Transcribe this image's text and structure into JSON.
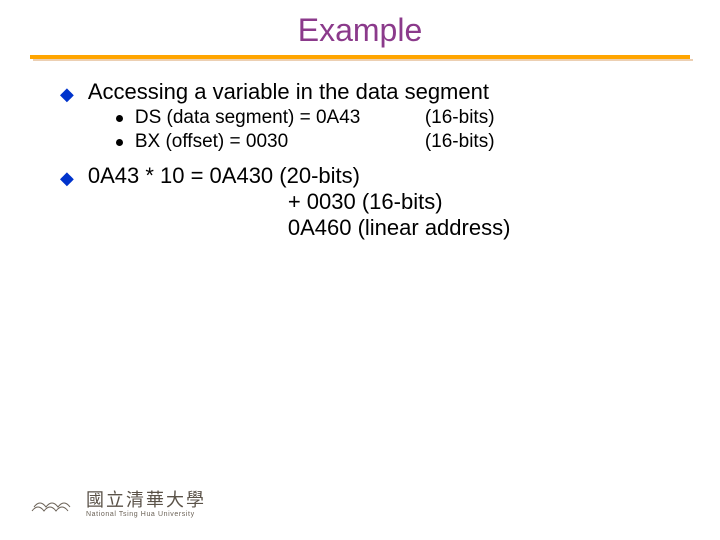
{
  "title": "Example",
  "point1": {
    "heading": "Accessing a variable in the data segment",
    "sub": [
      {
        "label": "DS (data segment) = 0A43",
        "bits": "(16-bits)"
      },
      {
        "label": "BX (offset) = 0030",
        "bits": "(16-bits)"
      }
    ]
  },
  "point2": {
    "line1": "0A43 * 10 = 0A430 (20-bits)",
    "line2": "+ 0030 (16-bits)",
    "line3": "0A460 (linear address)"
  },
  "footer": {
    "cn": "國立清華大學",
    "en": "National Tsing Hua University"
  },
  "colors": {
    "title": "#8B3A8B",
    "underline": "#FFA500",
    "bullet": "#0033cc"
  }
}
